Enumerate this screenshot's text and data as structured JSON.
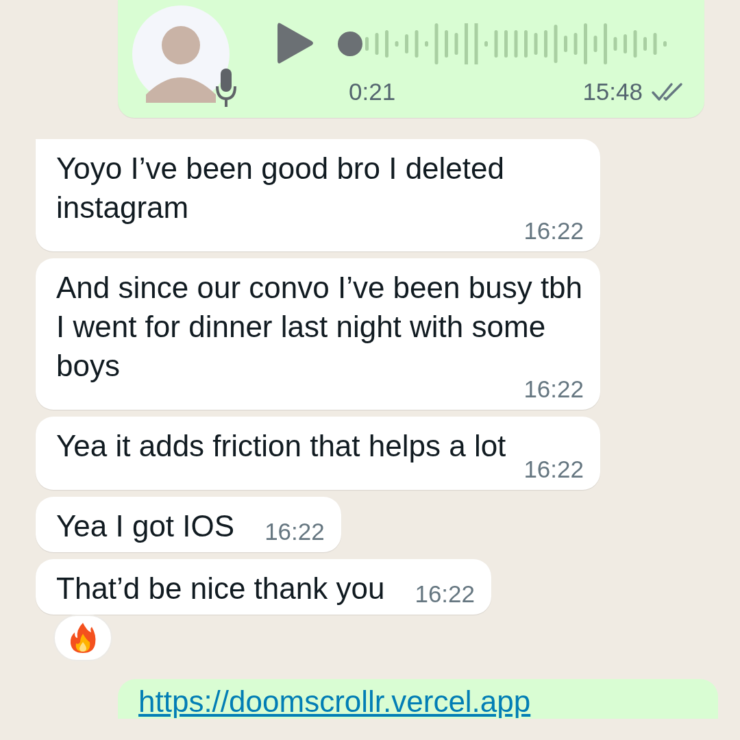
{
  "voice_message": {
    "duration": "0:21",
    "time": "15:48",
    "read": false
  },
  "messages": [
    {
      "text": "Yoyo I’ve been good bro I deleted instagram",
      "time": "16:22",
      "tail": true,
      "reaction": false
    },
    {
      "text": "And since our convo I’ve been busy tbh I went for dinner last night with some boys",
      "time": "16:22",
      "tail": false,
      "reaction": false
    },
    {
      "text": "Yea it adds friction that helps a lot",
      "time": "16:22",
      "tail": false,
      "reaction": false
    },
    {
      "text": "Yea I got IOS",
      "time": "16:22",
      "tail": false,
      "reaction": false
    },
    {
      "text": "That’d be nice thank you",
      "time": "16:22",
      "tail": false,
      "reaction": true
    }
  ],
  "link_message": {
    "url": "https://doomscrollr.vercel.app"
  }
}
